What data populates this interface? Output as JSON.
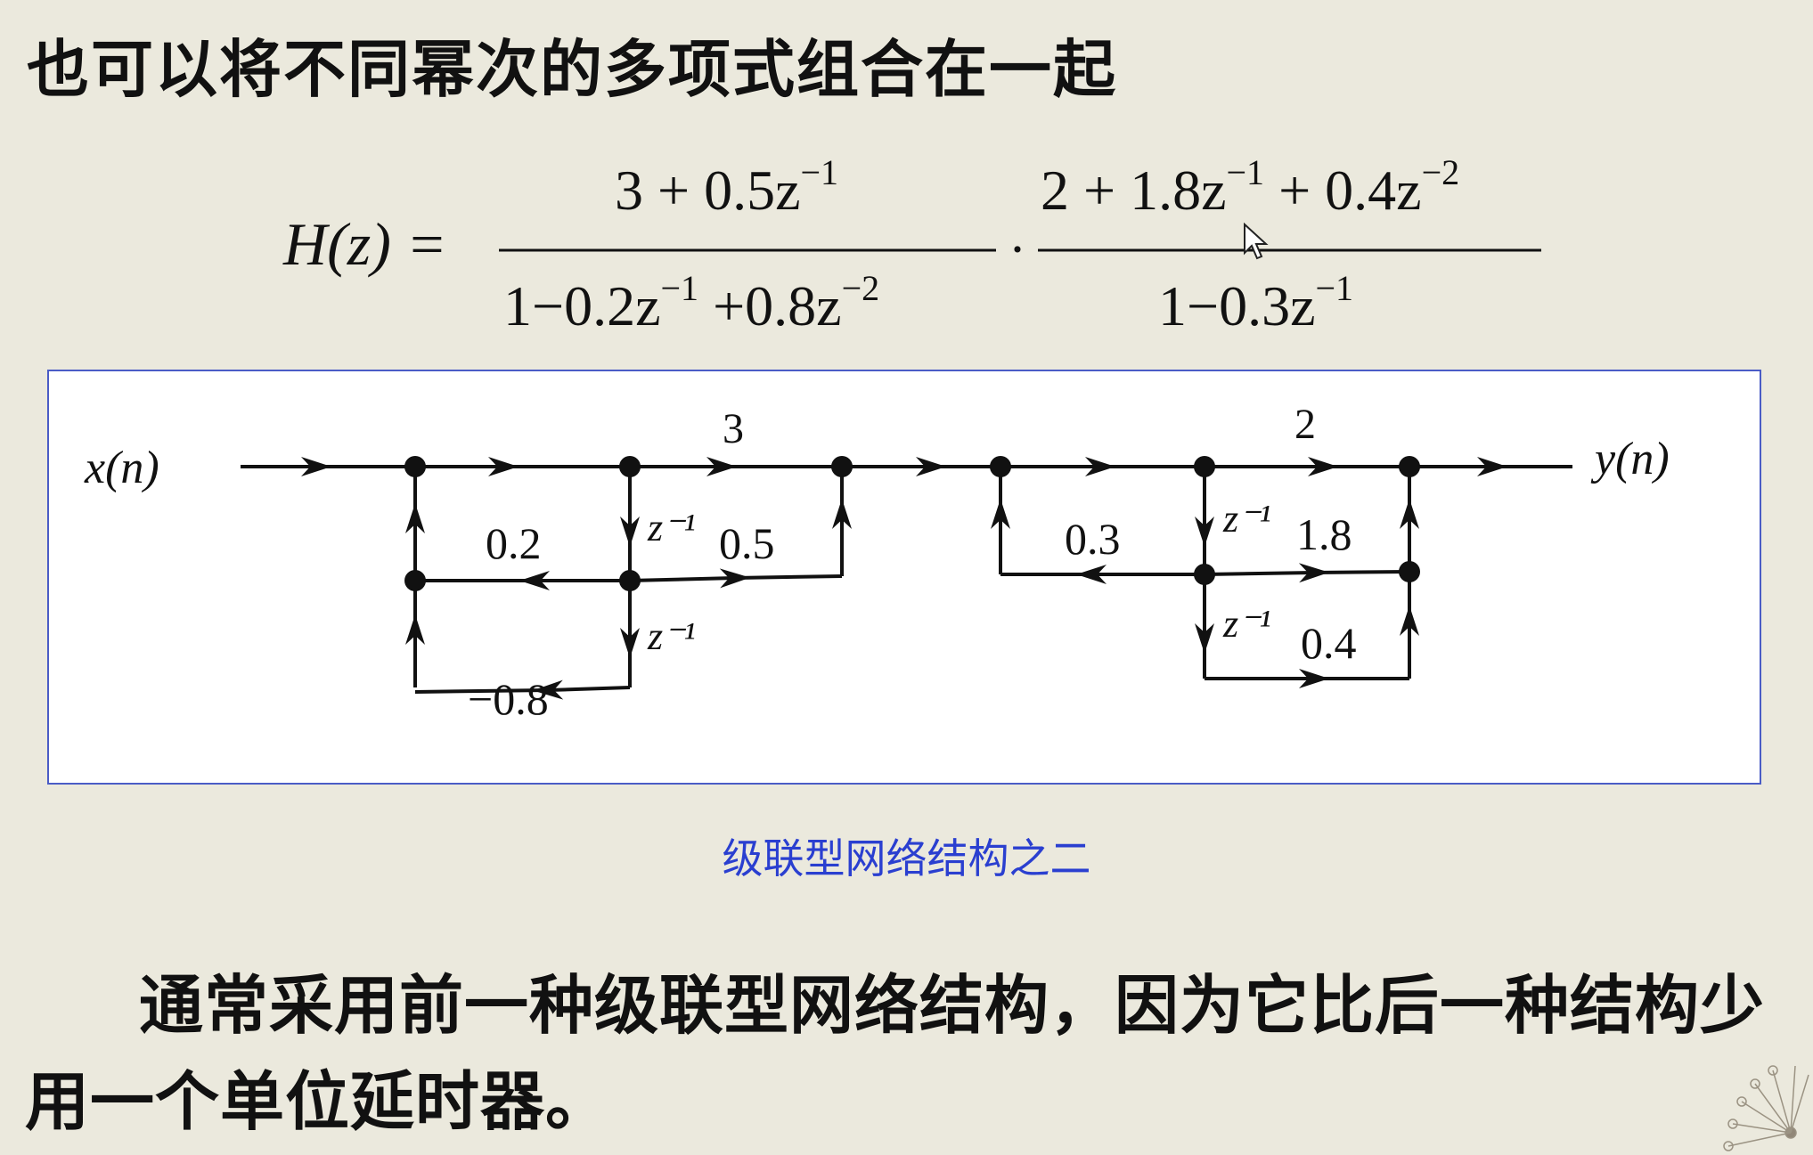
{
  "heading": "也可以将不同幂次的多项式组合在一起",
  "formula": {
    "lhs": "H(z) =",
    "factor1": {
      "numerator": [
        "3 + 0.5z",
        "−1"
      ],
      "denominator": [
        "1−0.2z",
        "−1",
        " +0.8z",
        "−2"
      ]
    },
    "dot": "·",
    "factor2": {
      "numerator": [
        "2 + 1.8z",
        "−1",
        " + 0.4z",
        "−2"
      ],
      "denominator": [
        "1−0.3z",
        "−1"
      ]
    }
  },
  "diagram": {
    "input_label": "x(n)",
    "output_label": "y(n)",
    "section1": {
      "forward_gain": "3",
      "feedback_gains": [
        "0.2",
        "−0.8"
      ],
      "feedforward_gain": "0.5",
      "delays": [
        "z⁻¹",
        "z⁻¹"
      ]
    },
    "section2": {
      "forward_gain": "2",
      "feedback_gain": "0.3",
      "feedforward_gains": [
        "1.8",
        "0.4"
      ],
      "delays": [
        "z⁻¹",
        "z⁻¹"
      ]
    }
  },
  "caption": "级联型网络结构之二",
  "paragraph": "通常采用前一种级联型网络结构，因为它比后一种结构少用一个单位延时器。",
  "colors": {
    "background": "#ebe9dd",
    "frame_border": "#4a5cc6",
    "caption": "#2a3fd0"
  }
}
